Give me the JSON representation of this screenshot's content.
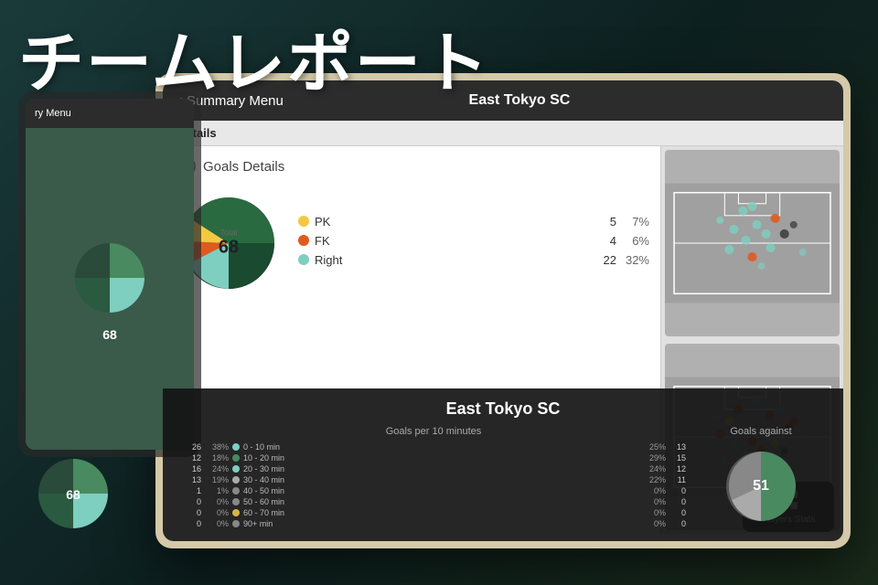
{
  "title": "チームレポート",
  "nav": {
    "back_label": "Summary Menu",
    "team_name": "East Tokyo SC"
  },
  "details_bar": {
    "label": "Details"
  },
  "goals_details": {
    "section_title": "Goals Details",
    "total": "68",
    "total_label": "Total",
    "legend": [
      {
        "name": "PK",
        "color": "#f5c842",
        "count": "5",
        "pct": "7%"
      },
      {
        "name": "FK",
        "color": "#e05a20",
        "count": "4",
        "pct": "6%"
      },
      {
        "name": "Right",
        "color": "#7ecfc0",
        "count": "22",
        "pct": "32%"
      }
    ]
  },
  "overlay": {
    "team_name": "East Tokyo SC"
  },
  "goals_per_10": {
    "title": "Goals per 10 minutes",
    "rows": [
      {
        "left_num": "26",
        "left_pct": "38%",
        "color": "#7ecfc0",
        "label": "0 - 10 min",
        "right_pct": "25%",
        "right_num": "13"
      },
      {
        "left_num": "12",
        "left_pct": "18%",
        "color": "#4a8a60",
        "label": "10 - 20 min",
        "right_pct": "29%",
        "right_num": "15"
      },
      {
        "left_num": "16",
        "left_pct": "24%",
        "color": "#7ecfc0",
        "label": "20 - 30 min",
        "right_pct": "24%",
        "right_num": "12"
      },
      {
        "left_num": "13",
        "left_pct": "19%",
        "color": "#aaaaaa",
        "label": "30 - 40 min",
        "right_pct": "22%",
        "right_num": "11"
      },
      {
        "left_num": "1",
        "left_pct": "1%",
        "color": "#888888",
        "label": "40 - 50 min",
        "right_pct": "0%",
        "right_num": "0"
      },
      {
        "left_num": "0",
        "left_pct": "0%",
        "color": "#888888",
        "label": "50 - 60 min",
        "right_pct": "0%",
        "right_num": "0"
      },
      {
        "left_num": "0",
        "left_pct": "0%",
        "color": "#d4b840",
        "label": "60 - 70 min",
        "right_pct": "0%",
        "right_num": "0"
      },
      {
        "left_num": "0",
        "left_pct": "0%",
        "color": "#888888",
        "label": "90+ min",
        "right_pct": "0%",
        "right_num": "0"
      }
    ]
  },
  "goals_against": {
    "title": "Goals against",
    "total": "51"
  },
  "players_stats": {
    "label": "Players Stats"
  },
  "bg_tablet": {
    "nav_text": "ry Menu"
  },
  "bottom_left_num": "68"
}
